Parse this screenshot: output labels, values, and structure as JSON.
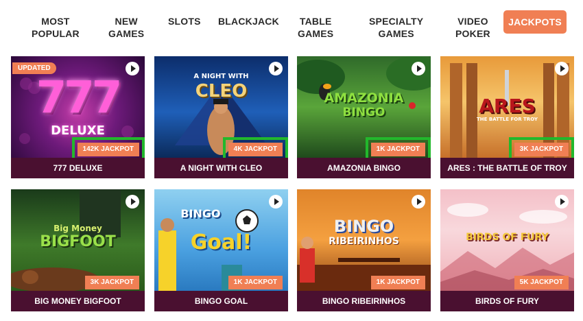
{
  "nav": {
    "items": [
      {
        "line1": "MOST",
        "line2": "POPULAR"
      },
      {
        "line1": "NEW",
        "line2": "GAMES"
      },
      {
        "line1": "SLOTS",
        "line2": ""
      },
      {
        "line1": "BLACKJACK",
        "line2": ""
      },
      {
        "line1": "TABLE",
        "line2": "GAMES"
      },
      {
        "line1": "SPECIALTY",
        "line2": "GAMES"
      },
      {
        "line1": "VIDEO",
        "line2": "POKER"
      }
    ],
    "active": "JACKPOTS"
  },
  "badge_updated": "UPDATED",
  "games": [
    {
      "title": "777 DELUXE",
      "jackpot": "142K JACKPOT",
      "logo1": "777",
      "logo2": "DELUXE"
    },
    {
      "title": "A NIGHT WITH CLEO",
      "jackpot": "4K JACKPOT",
      "logo1": "A NIGHT WITH",
      "logo2": "CLEO"
    },
    {
      "title": "AMAZONIA BINGO",
      "jackpot": "1K JACKPOT",
      "logo1": "AMAZONIA",
      "logo2": "BINGO"
    },
    {
      "title": "ARES : THE BATTLE OF TROY",
      "jackpot": "3K JACKPOT",
      "logo1": "ARES",
      "logo2": "THE BATTLE FOR TROY"
    },
    {
      "title": "BIG MONEY BIGFOOT",
      "jackpot": "3K JACKPOT",
      "logo1": "Big Money",
      "logo2": "BIGFOOT"
    },
    {
      "title": "BINGO GOAL",
      "jackpot": "1K JACKPOT",
      "logo1": "BINGO",
      "logo2": "Goal!"
    },
    {
      "title": "BINGO RIBEIRINHOS",
      "jackpot": "1K JACKPOT",
      "logo1": "BINGO",
      "logo2": "RIBEIRINHOS"
    },
    {
      "title": "BIRDS OF FURY",
      "jackpot": "5K JACKPOT",
      "logo1": "BIRDS OF FURY",
      "logo2": ""
    }
  ],
  "colors": {
    "accent": "#f07f54",
    "caption_bg": "#4a1030",
    "highlight": "#22b82c"
  }
}
